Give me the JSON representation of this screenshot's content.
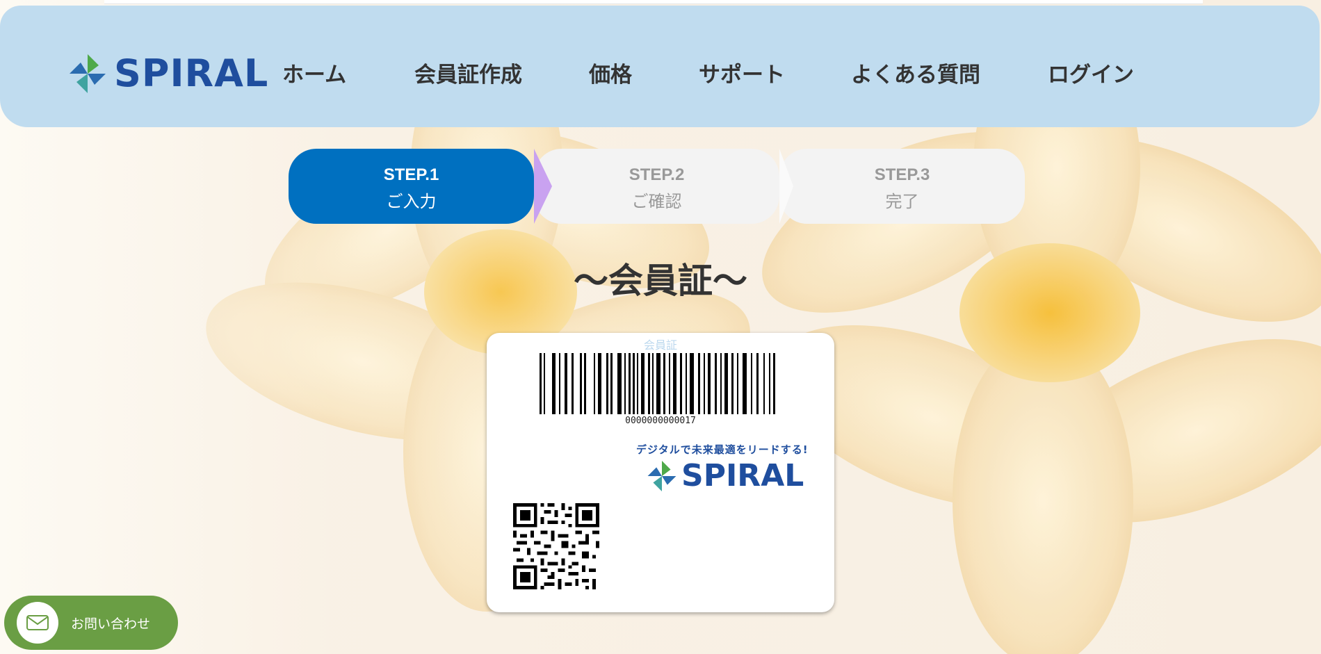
{
  "colors": {
    "header_bg": "#c0dcef",
    "brand": "#1f4e9e",
    "step_active": "#0070c0",
    "step_inactive": "#f3f3f3",
    "contact_bg": "#6a9e44"
  },
  "header": {
    "logo_text": "SPIRAL",
    "nav": [
      "ホーム",
      "会員証作成",
      "価格",
      "サポート",
      "よくある質問",
      "ログイン"
    ]
  },
  "steps": [
    {
      "label": "STEP.1",
      "sub": "ご入力",
      "active": true
    },
    {
      "label": "STEP.2",
      "sub": "ご確認",
      "active": false
    },
    {
      "label": "STEP.3",
      "sub": "完了",
      "active": false
    }
  ],
  "page_title": "～会員証～",
  "card": {
    "label": "会員証",
    "barcode_number": "0000000000017",
    "tagline": "デジタルで未来最適をリードする!",
    "logo_text": "SPIRAL"
  },
  "contact": {
    "label": "お問い合わせ",
    "icon": "mail-icon"
  }
}
